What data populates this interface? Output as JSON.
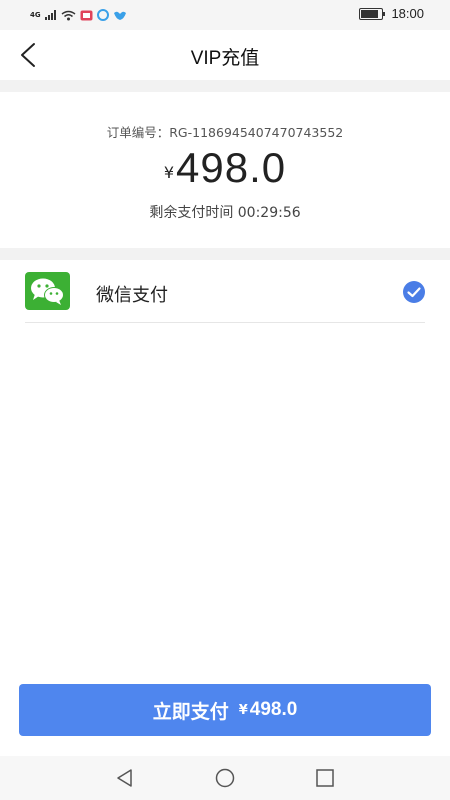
{
  "status_bar": {
    "network": "4G",
    "time": "18:00",
    "battery_level": 0.85,
    "colors": {
      "notification_red": "#e0435a",
      "notification_blue": "#3aa0e8"
    }
  },
  "header": {
    "title": "VIP充值",
    "back_icon": "chevron-left-icon"
  },
  "order": {
    "number_label": "订单编号：RG-1186945407470743552",
    "currency_symbol": "¥",
    "amount": "498.0",
    "countdown_label": "剩余支付时间 00:29:56"
  },
  "payment_methods": [
    {
      "label": "微信支付",
      "icon": "wechat-icon",
      "selected": true
    }
  ],
  "pay_button": {
    "label": "立即支付",
    "currency_symbol": "¥",
    "amount": "498.0"
  },
  "colors": {
    "accent": "#4f86ee",
    "check": "#4a7de6",
    "wechat_green": "#3cb034",
    "divider": "#e6e6e6",
    "background_gap": "#f2f2f2"
  }
}
